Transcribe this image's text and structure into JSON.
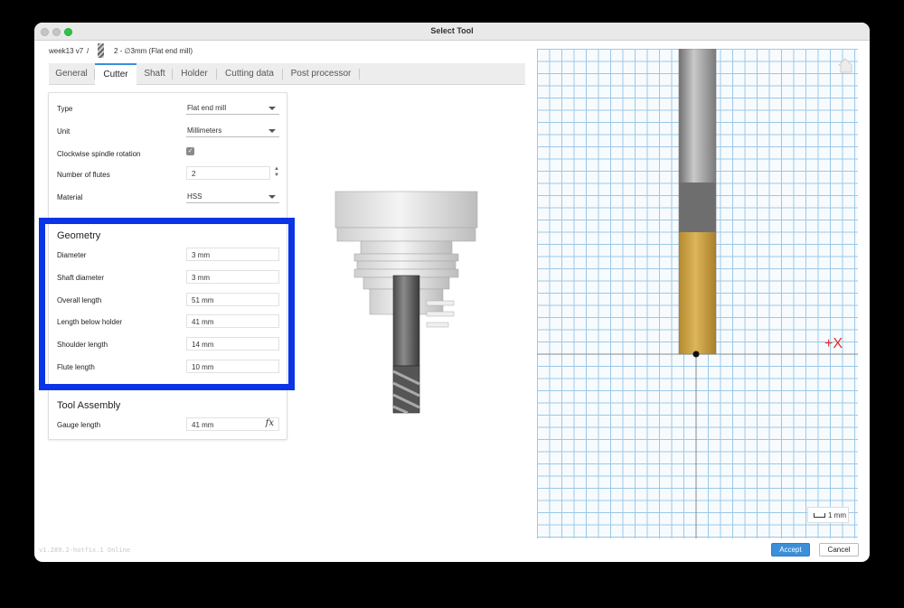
{
  "window": {
    "title": "Select Tool"
  },
  "breadcrumb": {
    "project": "week13 v7",
    "separator": "/",
    "tool": "2 - ∅3mm (Flat end mill)"
  },
  "tabs": [
    {
      "label": "General",
      "active": false
    },
    {
      "label": "Cutter",
      "active": true
    },
    {
      "label": "Shaft",
      "active": false
    },
    {
      "label": "Holder",
      "active": false
    },
    {
      "label": "Cutting data",
      "active": false
    },
    {
      "label": "Post processor",
      "active": false
    }
  ],
  "cutter": {
    "type": {
      "label": "Type",
      "value": "Flat end mill"
    },
    "unit": {
      "label": "Unit",
      "value": "Millimeters"
    },
    "clockwise": {
      "label": "Clockwise spindle rotation",
      "checked": true
    },
    "flutes": {
      "label": "Number of flutes",
      "value": "2"
    },
    "material": {
      "label": "Material",
      "value": "HSS"
    }
  },
  "geometry": {
    "title": "Geometry",
    "diameter": {
      "label": "Diameter",
      "value": "3 mm"
    },
    "shaft_diameter": {
      "label": "Shaft diameter",
      "value": "3 mm"
    },
    "overall_length": {
      "label": "Overall length",
      "value": "51 mm"
    },
    "length_below_holder": {
      "label": "Length below holder",
      "value": "41 mm"
    },
    "shoulder_length": {
      "label": "Shoulder length",
      "value": "14 mm"
    },
    "flute_length": {
      "label": "Flute length",
      "value": "10 mm"
    }
  },
  "tool_assembly": {
    "title": "Tool Assembly",
    "gauge_length": {
      "label": "Gauge length",
      "value": "41 mm",
      "fx": "fx"
    }
  },
  "viewport": {
    "axis_label": "+X",
    "scale_label": "1 mm"
  },
  "footer": {
    "version": "v1.289.2-hotfix.1 Online",
    "accept": "Accept",
    "cancel": "Cancel"
  },
  "colors": {
    "accent": "#3b8fd9",
    "highlight": "#0a34e6",
    "flute": "#c99a3a",
    "axis": "#e03030"
  }
}
